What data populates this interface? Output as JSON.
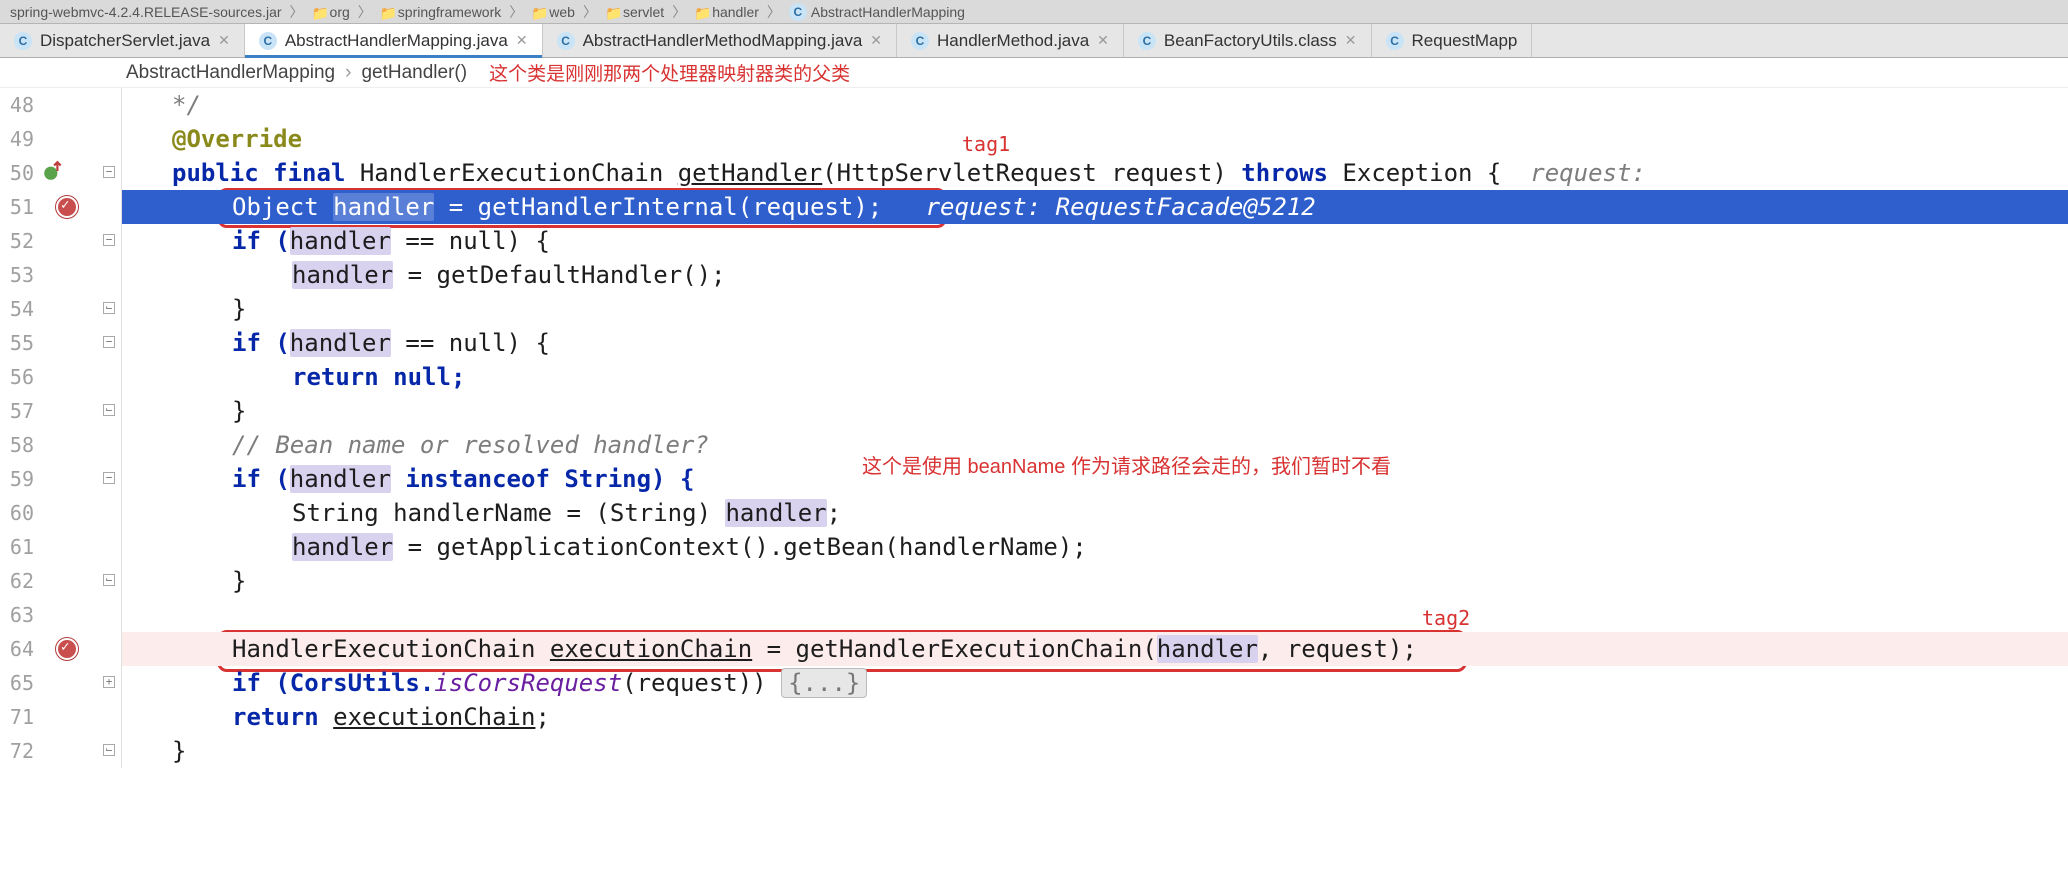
{
  "topbar": {
    "jar": "spring-webmvc-4.2.4.RELEASE-sources.jar",
    "segments": [
      "org",
      "springframework",
      "web",
      "servlet",
      "handler",
      "AbstractHandlerMapping"
    ]
  },
  "tabs": [
    {
      "label": "DispatcherServlet.java",
      "active": false,
      "closable": true
    },
    {
      "label": "AbstractHandlerMapping.java",
      "active": true,
      "closable": true
    },
    {
      "label": "AbstractHandlerMethodMapping.java",
      "active": false,
      "closable": true
    },
    {
      "label": "HandlerMethod.java",
      "active": false,
      "closable": true
    },
    {
      "label": "BeanFactoryUtils.class",
      "active": false,
      "closable": true
    },
    {
      "label": "RequestMapp",
      "active": false,
      "closable": false
    }
  ],
  "breadcrumb": {
    "class": "AbstractHandlerMapping",
    "method": "getHandler()",
    "note": "这个类是刚刚那两个处理器映射器类的父类"
  },
  "gutter": {
    "start": 48,
    "lines": [
      48,
      49,
      50,
      51,
      52,
      53,
      54,
      55,
      56,
      57,
      58,
      59,
      60,
      61,
      62,
      63,
      64,
      65,
      71,
      72
    ]
  },
  "annotations": {
    "tag1": "tag1",
    "tag2": "tag2",
    "beanNote": "这个是使用 beanName 作为请求路径会走的，我们暂时不看"
  },
  "code": {
    "l48": "*/",
    "l49": "@Override",
    "l50_pre": "public final ",
    "l50_type": "HandlerExecutionChain ",
    "l50_name": "getHandler",
    "l50_sig": "(HttpServletRequest request) ",
    "l50_throws": "throws ",
    "l50_exc": "Exception {",
    "l50_hint": "  request:",
    "l51_a": "Object ",
    "l51_var": "handler",
    "l51_b": " = getHandlerInternal(request);",
    "l51_hint": "   request: RequestFacade@5212",
    "l52_a": "if (",
    "l52_var": "handler",
    "l52_b": " == null) {",
    "l53_var": "handler",
    "l53_b": " = getDefaultHandler();",
    "l54": "}",
    "l55_a": "if (",
    "l55_var": "handler",
    "l55_b": " == null) {",
    "l56": "return null;",
    "l57": "}",
    "l58": "// Bean name or resolved handler?",
    "l59_a": "if (",
    "l59_var": "handler",
    "l59_b": " instanceof String) {",
    "l60_a": "String handlerName = (String) ",
    "l60_var": "handler",
    "l60_b": ";",
    "l61_var": "handler",
    "l61_b": " = getApplicationContext().getBean(handlerName);",
    "l62": "}",
    "l64_a": "HandlerExecutionChain ",
    "l64_var": "executionChain",
    "l64_b": " = getHandlerExecutionChain(",
    "l64_var2": "handler",
    "l64_c": ", request);",
    "l65_a": "if (CorsUtils.",
    "l65_i": "isCorsRequest",
    "l65_b": "(request)) ",
    "l65_fold": "{...}",
    "l71_a": "return ",
    "l71_var": "executionChain",
    "l71_b": ";",
    "l72": "}"
  }
}
